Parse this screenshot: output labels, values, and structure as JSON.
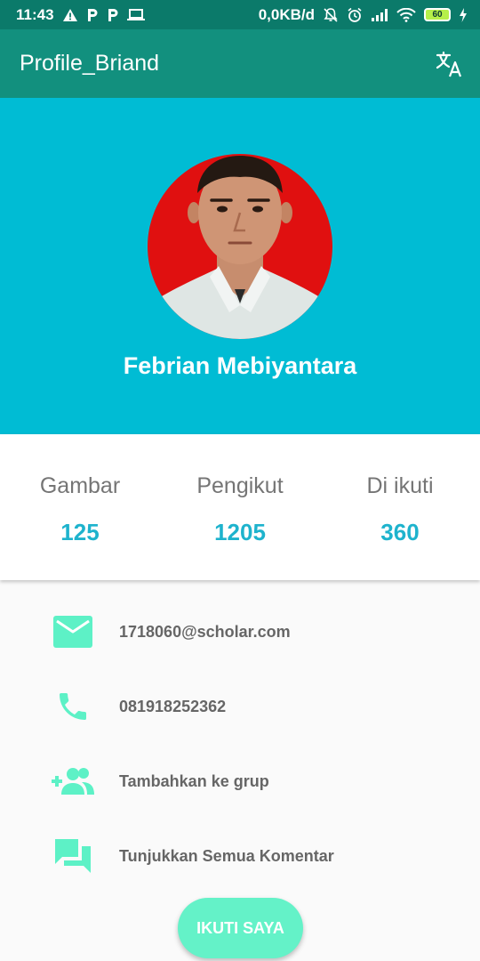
{
  "status_bar": {
    "time": "11:43",
    "network_speed": "0,0KB/d",
    "battery_level": "60",
    "icons": [
      "warning-icon",
      "parking-icon",
      "parking-icon",
      "laptop-icon",
      "mute-icon",
      "alarm-icon",
      "signal-icon",
      "wifi-icon",
      "battery-icon",
      "charging-icon"
    ]
  },
  "app_bar": {
    "title": "Profile_Briand",
    "action_icon": "translate-icon"
  },
  "profile": {
    "name": "Febrian Mebiyantara",
    "colors": {
      "header_bg": "#00bcd4",
      "photo_bg": "#e01010"
    }
  },
  "stats": [
    {
      "label": "Gambar",
      "value": "125"
    },
    {
      "label": "Pengikut",
      "value": "1205"
    },
    {
      "label": "Di ikuti",
      "value": "360"
    }
  ],
  "info": [
    {
      "icon": "email-icon",
      "text": "1718060@scholar.com"
    },
    {
      "icon": "phone-icon",
      "text": "081918252362"
    },
    {
      "icon": "group-add-icon",
      "text": "Tambahkan ke grup"
    },
    {
      "icon": "comments-icon",
      "text": "Tunjukkan Semua Komentar"
    }
  ],
  "follow_button": {
    "label": "IKUTI SAYA"
  },
  "colors": {
    "status_bar": "#0b7a6a",
    "app_bar": "#12907e",
    "accent": "#1eb3cd",
    "icon_mint": "#5df1c6",
    "button": "#64f2c8"
  }
}
